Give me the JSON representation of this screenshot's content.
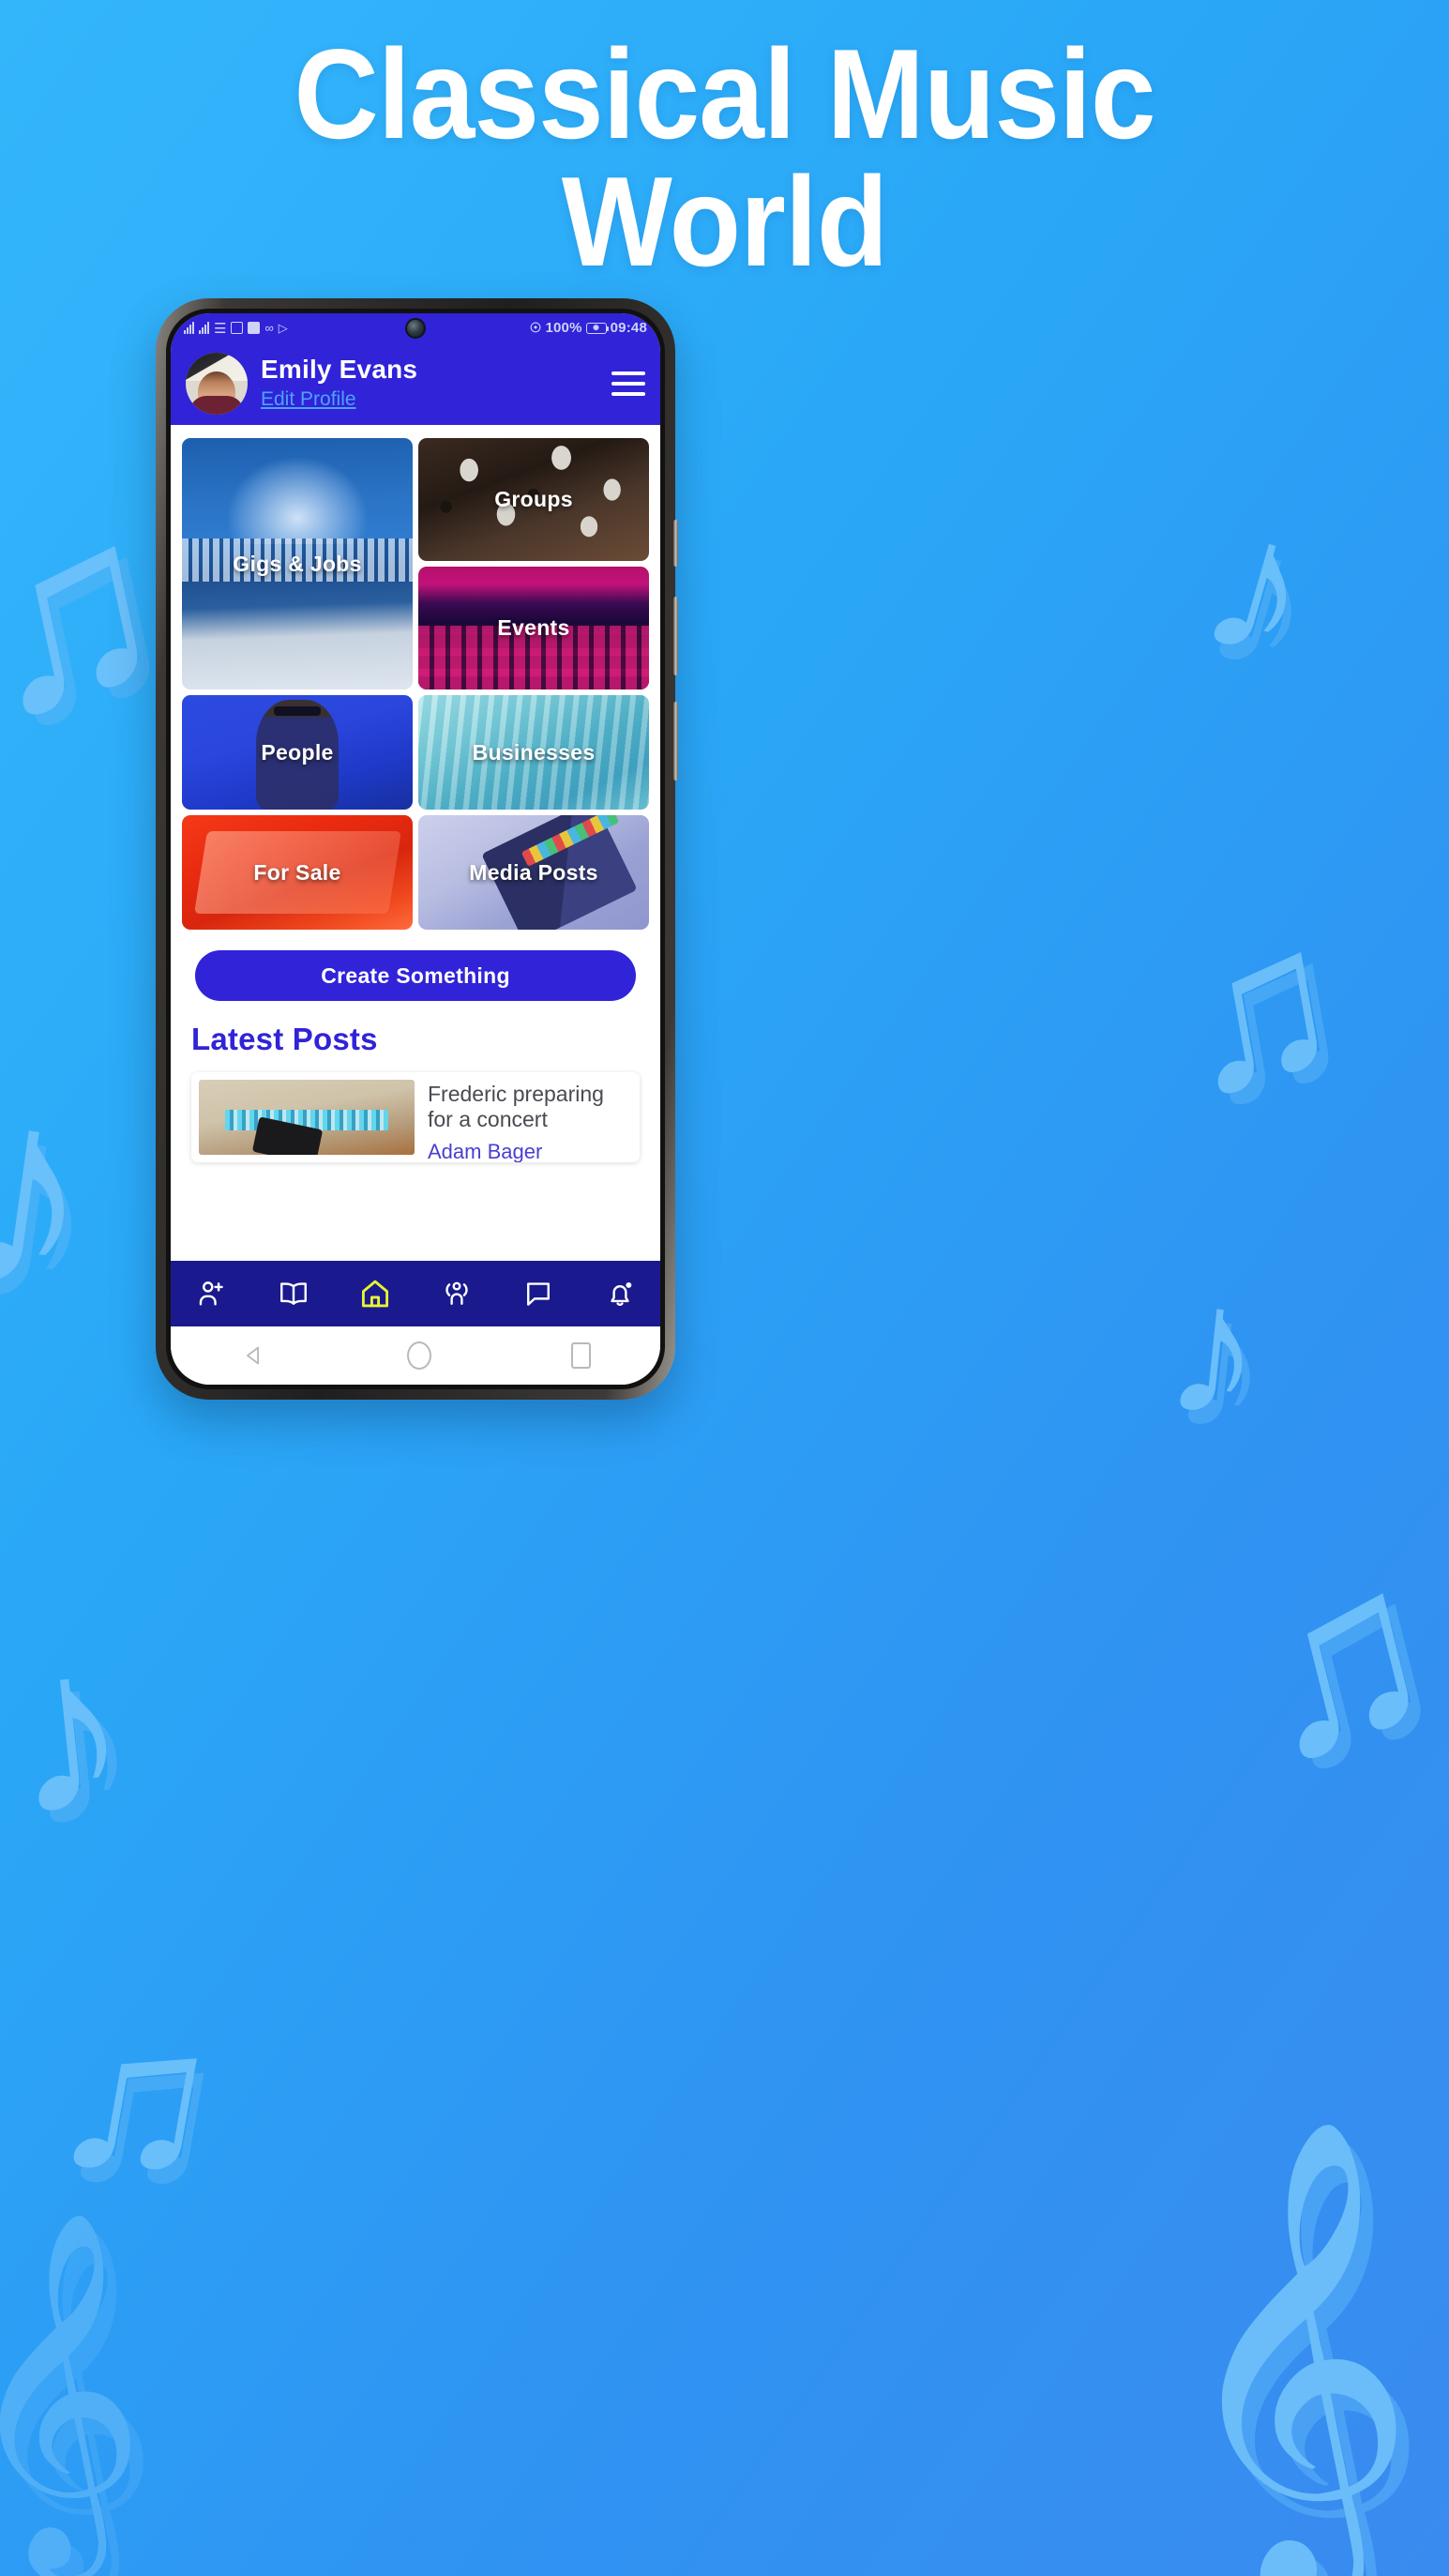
{
  "hero": {
    "title_line1": "Classical Music",
    "title_line2": "World",
    "bg_color": "#2fabf8",
    "title_color": "#ffffff"
  },
  "phone": {
    "statusbar": {
      "icons_left": [
        "signal-bars-icon",
        "signal-bars-icon",
        "wifi-icon",
        "document-icon",
        "app-icon",
        "bluetooth-audio-icon",
        "play-icon"
      ],
      "location_icon": "location-pin-icon",
      "battery_percent": "100%",
      "battery_icon": "battery-eco-icon",
      "time": "09:48"
    },
    "app_header": {
      "user_name": "Emily Evans",
      "edit_profile_label": "Edit Profile",
      "menu_icon": "hamburger-menu-icon",
      "avatar_icon": "user-avatar",
      "bg_color": "#3023d8",
      "link_color": "#4ea2f7"
    },
    "tiles": [
      {
        "label": "Gigs & Jobs",
        "art": "art-gigs",
        "name": "tile-gigs-jobs"
      },
      {
        "label": "Groups",
        "art": "art-groups",
        "name": "tile-groups"
      },
      {
        "label": "Events",
        "art": "art-events",
        "name": "tile-events"
      },
      {
        "label": "People",
        "art": "art-people",
        "name": "tile-people"
      },
      {
        "label": "Businesses",
        "art": "art-biz",
        "name": "tile-businesses"
      },
      {
        "label": "For Sale",
        "art": "art-sale",
        "name": "tile-for-sale"
      },
      {
        "label": "Media Posts",
        "art": "art-media",
        "name": "tile-media-posts"
      }
    ],
    "cta": {
      "label": "Create Something",
      "color": "#3023d8"
    },
    "latest_posts": {
      "heading": "Latest Posts",
      "heading_color": "#3023d8",
      "posts": [
        {
          "title": "Frederic preparing for a concert",
          "author": "Adam Bager"
        }
      ]
    },
    "bottom_nav": {
      "bg_color": "#1a1a8e",
      "active_color": "#e8f534",
      "items": [
        {
          "icon": "add-person-icon",
          "name": "nav-add-person",
          "active": false
        },
        {
          "icon": "book-icon",
          "name": "nav-book",
          "active": false
        },
        {
          "icon": "home-icon",
          "name": "nav-home",
          "active": true
        },
        {
          "icon": "people-group-icon",
          "name": "nav-groups",
          "active": false
        },
        {
          "icon": "chat-bubble-icon",
          "name": "nav-messages",
          "active": false
        },
        {
          "icon": "bell-icon",
          "name": "nav-notifications",
          "active": false,
          "badge": true
        }
      ]
    },
    "android_nav": {
      "back_icon": "triangle-back-icon",
      "home_icon": "circle-home-icon",
      "recents_icon": "square-recents-icon"
    }
  }
}
